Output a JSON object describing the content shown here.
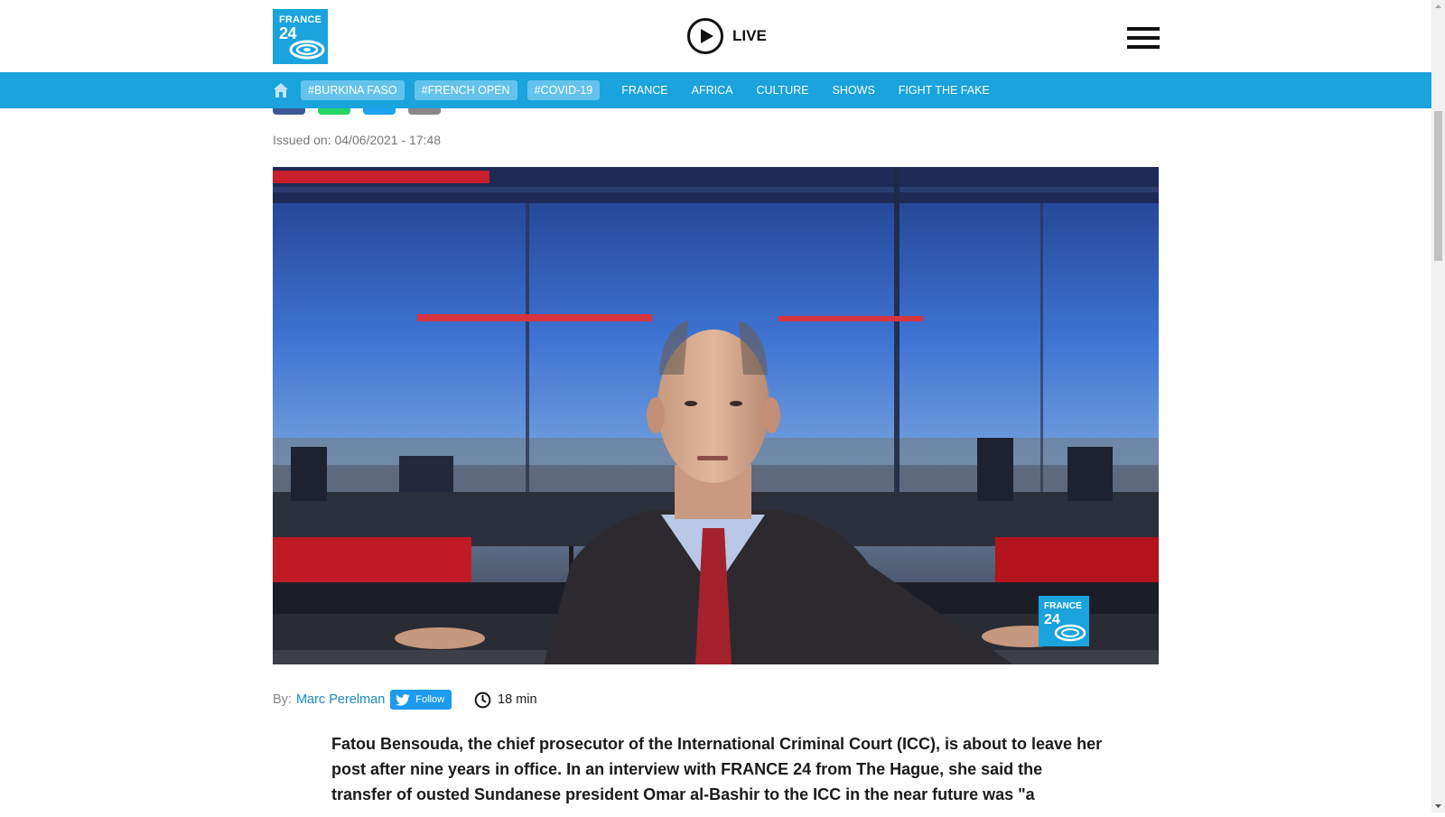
{
  "header": {
    "logo_line1": "FRANCE",
    "logo_line2": "24",
    "live_label": "LIVE"
  },
  "nav": {
    "tags": [
      "#BURKINA FASO",
      "#FRENCH OPEN",
      "#COVID-19"
    ],
    "links": [
      "FRANCE",
      "AFRICA",
      "CULTURE",
      "SHOWS",
      "FIGHT THE FAKE"
    ]
  },
  "article": {
    "issued": "Issued on: 04/06/2021 - 17:48",
    "hero_logo_line1": "FRANCE",
    "hero_logo_line2": "24",
    "by_label": "By:",
    "author": "Marc Perelman",
    "follow_label": "Follow",
    "read_time": "18 min",
    "lead_lines": [
      "Fatou Bensouda, the chief prosecutor of the International Criminal Court (ICC), is about to leave her",
      "post after nine years in office. In an interview with FRANCE 24 from The Hague, she said the",
      "transfer of ousted Sundanese president Omar al-Bashir to the ICC in the near future was \"a"
    ]
  },
  "colors": {
    "brand": "#1aa3dc",
    "tag_bg": "#63c3ec",
    "author_link": "#1a8ac2",
    "twitter": "#1d9bf0"
  },
  "icons": [
    "home-icon",
    "play-icon",
    "hamburger-menu-icon",
    "twitter-bird-icon",
    "clock-icon",
    "facebook-share",
    "whatsapp-share",
    "twitter-share",
    "email-share"
  ]
}
